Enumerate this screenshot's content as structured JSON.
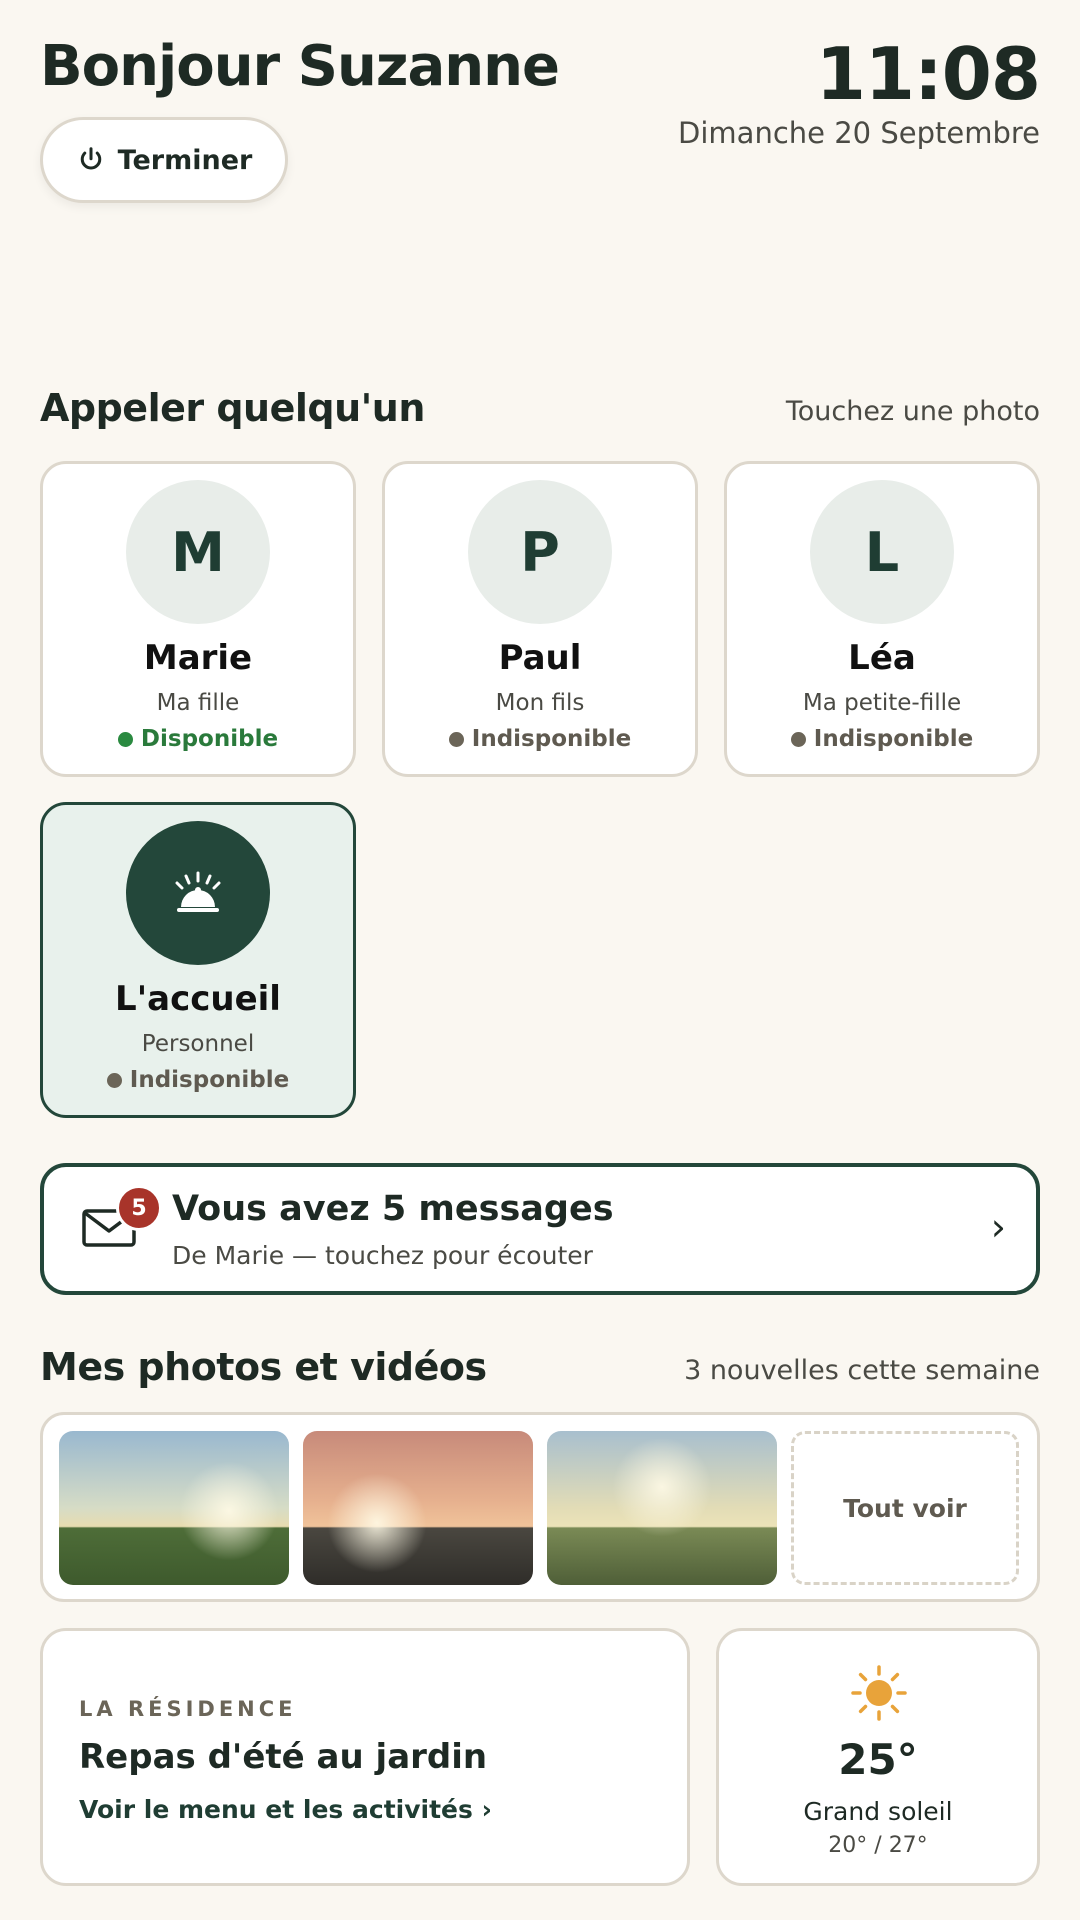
{
  "header": {
    "greeting": "Bonjour Suzanne",
    "time": "11:08",
    "date": "Dimanche 20 Septembre",
    "end_button_label": "Terminer"
  },
  "calls": {
    "title": "Appeler quelqu'un",
    "hint": "Touchez une photo",
    "contacts": [
      {
        "initial": "M",
        "name": "Marie",
        "relation": "Ma fille",
        "status": "Disponible",
        "available": true
      },
      {
        "initial": "P",
        "name": "Paul",
        "relation": "Mon fils",
        "status": "Indisponible",
        "available": false
      },
      {
        "initial": "L",
        "name": "Léa",
        "relation": "Ma petite-fille",
        "status": "Indisponible",
        "available": false
      },
      {
        "icon": "reception-bell-icon",
        "name": "L'accueil",
        "relation": "Personnel",
        "status": "Indisponible",
        "available": false
      }
    ]
  },
  "messages": {
    "count": "5",
    "title": "Vous avez 5 messages",
    "subtitle": "De Marie — touchez pour écouter",
    "chevron": "›"
  },
  "photos": {
    "title": "Mes photos et vidéos",
    "hint": "3 nouvelles cette semaine",
    "see_all_label": "Tout voir"
  },
  "residence": {
    "kicker": "LA RÉSIDENCE",
    "title": "Repas d'été au jardin",
    "link": "Voir le menu et les activités ›"
  },
  "weather": {
    "icon": "sun-icon",
    "temperature": "25°",
    "condition": "Grand soleil",
    "range": "20° / 27°"
  },
  "colors": {
    "background": "#faf7f1",
    "accent": "#23473a",
    "available": "#2a8a40",
    "badge": "#a8342a",
    "sun": "#e8a33a"
  }
}
